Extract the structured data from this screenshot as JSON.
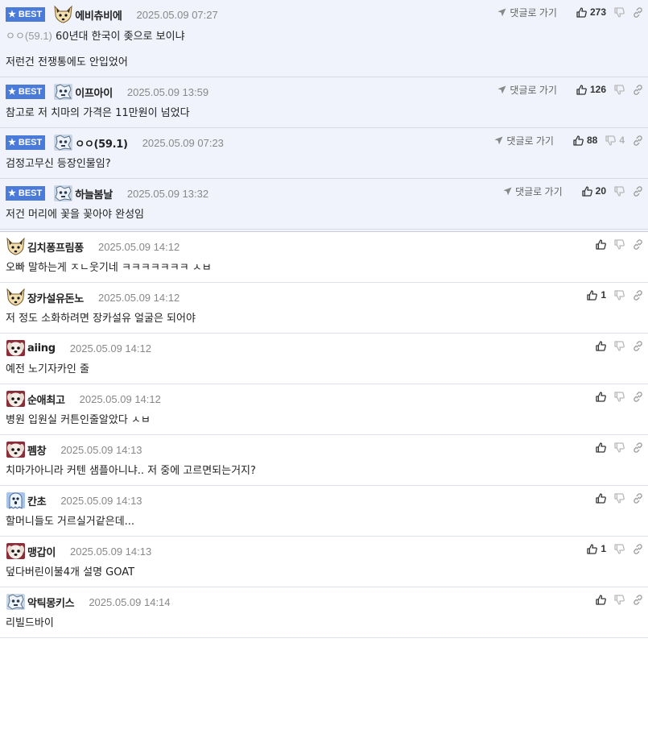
{
  "labels": {
    "best": "BEST",
    "reply": "댓글로 가기"
  },
  "colors": {
    "best_bg": "#f0f3fb",
    "badge": "#4a7bd8",
    "date": "#888888"
  },
  "best_comments": [
    {
      "avatar": "fox-icon",
      "nick": "에비츄비에",
      "date": "2025.05.09 07:27",
      "up": "273",
      "down": "",
      "ref": "ㅇㅇ(59.1)",
      "text": "60년대 한국이 좆으로 보이냐\n\n저런건 전쟁통에도 안입었어"
    },
    {
      "avatar": "robot-icon",
      "nick": "이프아이",
      "date": "2025.05.09 13:59",
      "up": "126",
      "down": "",
      "ref": "",
      "text": "참고로 저 치마의 가격은 11만원이 넘었다"
    },
    {
      "avatar": "robot-icon",
      "nick": "ㅇㅇ(59.1)",
      "date": "2025.05.09 07:23",
      "up": "88",
      "down": "4",
      "ref": "",
      "text": "검정고무신 등장인물임?"
    },
    {
      "avatar": "robot-icon",
      "nick": "하늘봄날",
      "date": "2025.05.09 13:32",
      "up": "20",
      "down": "",
      "ref": "",
      "text": "저건 머리에 꽃을 꽂아야 완성임"
    }
  ],
  "comments": [
    {
      "avatar": "fox-icon",
      "nick": "김치퐁프림퐁",
      "date": "2025.05.09 14:12",
      "up": "",
      "text": "오빠 말하는게 ㅈㄴ웃기네 ㅋㅋㅋㅋㅋㅋㅋ ㅅㅂ"
    },
    {
      "avatar": "fox-icon",
      "nick": "장카설유돈노",
      "date": "2025.05.09 14:12",
      "up": "1",
      "text": "저 정도 소화하려면 장카설유 얼굴은 되어야"
    },
    {
      "avatar": "dog-icon",
      "nick": "aiing",
      "date": "2025.05.09 14:12",
      "up": "",
      "text": "예전 노기자카인 줄"
    },
    {
      "avatar": "dog-icon",
      "nick": "순애최고",
      "date": "2025.05.09 14:12",
      "up": "",
      "text": "병원 입원실 커튼인줄알았다 ㅅㅂ"
    },
    {
      "avatar": "dog-icon",
      "nick": "펨창",
      "date": "2025.05.09 14:13",
      "up": "",
      "text": "치마가아니라 커텐 샘플아니냐.. 저 중에 고르면되는거지?"
    },
    {
      "avatar": "ghost-icon",
      "nick": "칸초",
      "date": "2025.05.09 14:13",
      "up": "",
      "text": "할머니들도 거르실거같은데..."
    },
    {
      "avatar": "dog-icon",
      "nick": "맹갑이",
      "date": "2025.05.09 14:13",
      "up": "1",
      "text": "덮다버린이불4개 설명 GOAT"
    },
    {
      "avatar": "robot-icon",
      "nick": "악틱몽키스",
      "date": "2025.05.09 14:14",
      "up": "",
      "text": "리빌드바이"
    }
  ]
}
